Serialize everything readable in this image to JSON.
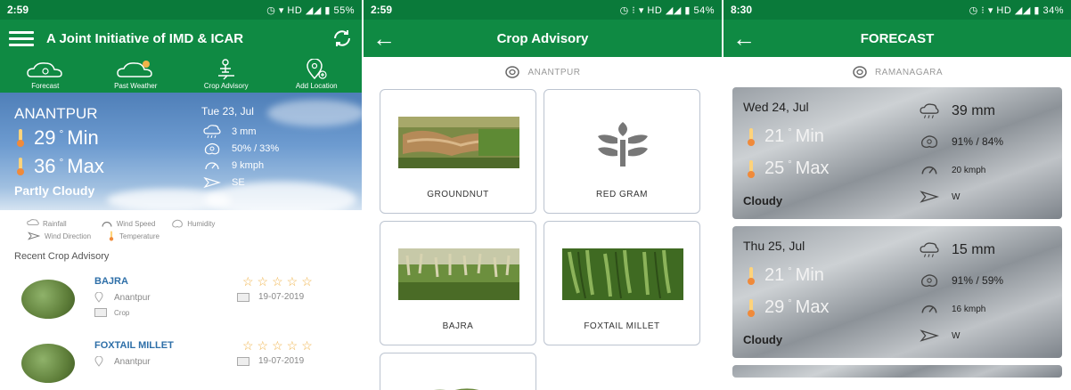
{
  "colors": {
    "primary_green": "#0f8a43",
    "status_green": "#0a7a3a",
    "link_blue": "#2e6fa8",
    "star": "#f0b34a"
  },
  "screen1": {
    "status": {
      "time": "2:59",
      "right": "55%"
    },
    "title": "A Joint Initiative of IMD & ICAR",
    "nav": [
      {
        "label": "Forecast",
        "icon": "cloud-sun-icon"
      },
      {
        "label": "Past Weather",
        "icon": "cloud-sun-icon"
      },
      {
        "label": "Crop Advisory",
        "icon": "crop-advisory-icon"
      },
      {
        "label": "Add Location",
        "icon": "add-location-icon"
      }
    ],
    "hero": {
      "city": "ANANTPUR",
      "date": "Tue 23, Jul",
      "min_value": "29",
      "min_label": "Min",
      "max_value": "36",
      "max_label": "Max",
      "condition": "Partly Cloudy",
      "rain": "3 mm",
      "humidity": "50% / 33%",
      "wind_speed": "9 kmph",
      "wind_dir": "SE"
    },
    "legend": {
      "rainfall": "Rainfall",
      "wind_speed": "Wind Speed",
      "humidity": "Humidity",
      "wind_direction": "Wind Direction",
      "temperature": "Temperature"
    },
    "recent_heading": "Recent Crop Advisory",
    "advisories": [
      {
        "name": "BAJRA",
        "location": "Anantpur",
        "tag": "Crop",
        "date": "19-07-2019",
        "stars": "☆☆☆☆☆"
      },
      {
        "name": "FOXTAIL MILLET",
        "location": "Anantpur",
        "tag": "",
        "date": "19-07-2019",
        "stars": "☆☆☆☆☆"
      }
    ]
  },
  "screen2": {
    "status": {
      "time": "2:59",
      "right": "54%"
    },
    "title": "Crop Advisory",
    "location": "ANANTPUR",
    "crops": [
      {
        "label": "GROUNDNUT"
      },
      {
        "label": "RED GRAM"
      },
      {
        "label": "BAJRA"
      },
      {
        "label": "FOXTAIL MILLET"
      }
    ]
  },
  "screen3": {
    "status": {
      "time": "8:30",
      "right": "34%"
    },
    "title": "FORECAST",
    "location": "RAMANAGARA",
    "days": [
      {
        "date": "Wed 24, Jul",
        "min_value": "21",
        "min_label": "Min",
        "max_value": "25",
        "max_label": "Max",
        "condition": "Cloudy",
        "rain": "39 mm",
        "humidity": "91% / 84%",
        "wind_speed": "20 kmph",
        "wind_dir": "W"
      },
      {
        "date": "Thu 25, Jul",
        "min_value": "21",
        "min_label": "Min",
        "max_value": "29",
        "max_label": "Max",
        "condition": "Cloudy",
        "rain": "15 mm",
        "humidity": "91% / 59%",
        "wind_speed": "16 kmph",
        "wind_dir": "W"
      }
    ]
  }
}
